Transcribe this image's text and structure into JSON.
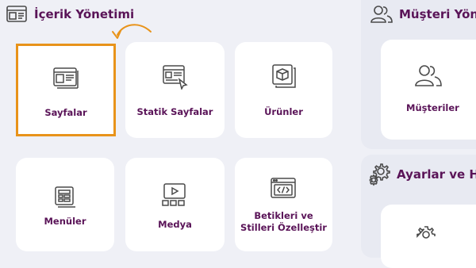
{
  "content_management": {
    "title": "İçerik Yönetimi",
    "cards": [
      {
        "label": "Sayfalar",
        "icon": "pages-icon",
        "selected": true
      },
      {
        "label": "Statik Sayfalar",
        "icon": "static-pages-icon",
        "selected": false
      },
      {
        "label": "Ürünler",
        "icon": "products-icon",
        "selected": false
      },
      {
        "label": "Menüler",
        "icon": "menus-icon",
        "selected": false
      },
      {
        "label": "Medya",
        "icon": "media-icon",
        "selected": false
      },
      {
        "label": "Betikleri ve Stilleri Özelleştir",
        "icon": "scripts-styles-icon",
        "selected": false
      }
    ]
  },
  "customer_management": {
    "title": "Müşteri Yönet",
    "cards": [
      {
        "label": "Müşteriler",
        "icon": "customers-icon"
      }
    ]
  },
  "settings": {
    "title": "Ayarlar ve Hiz",
    "icon": "gear-icon"
  },
  "colors": {
    "accent": "#e8931a",
    "brand_text": "#5a1458",
    "icon": "#4a4a4a",
    "background": "#eff0f6",
    "card": "#ffffff"
  }
}
